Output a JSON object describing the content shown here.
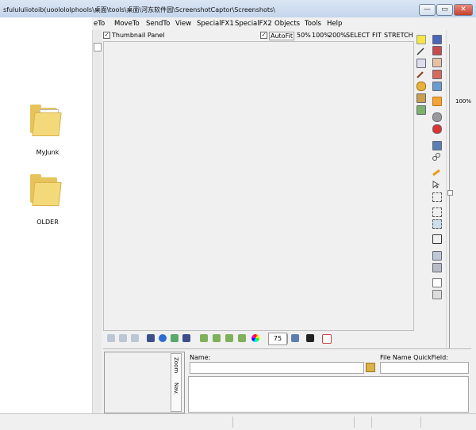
{
  "window": {
    "title": "sfulululiotoib(uoolololphools\\桌面\\tools\\桌面\\河东软件园\\ScreenshotCaptor\\Screenshots\\",
    "min": "—",
    "max": "▭",
    "close": "✕"
  },
  "menu": [
    {
      "label": "eTo"
    },
    {
      "label": "MoveTo"
    },
    {
      "label": "SendTo"
    },
    {
      "label": "View"
    },
    {
      "label": "SpecialFX1"
    },
    {
      "label": "SpecialFX2"
    },
    {
      "label": "Objects"
    },
    {
      "label": "Tools"
    },
    {
      "label": "Help"
    }
  ],
  "thumbnail_panel": {
    "label": "Thumbnail Panel",
    "checked": true
  },
  "autofit": {
    "label": "AutoFit",
    "checked": true
  },
  "zoom_presets": [
    "50%",
    "100%",
    "200%",
    "SELECT",
    "FIT",
    "STRETCH"
  ],
  "ruler": {
    "zoom_label": "100%"
  },
  "folders": [
    {
      "name": "MyJunk"
    },
    {
      "name": "OLDER"
    }
  ],
  "bottom_toolbar": {
    "zoom_value": "75"
  },
  "side_tabs": {
    "zoom": "Zoom",
    "nav": "Nav."
  },
  "name_field": {
    "label": "Name:",
    "value": ""
  },
  "quickfield": {
    "label": "File Name QuickField:",
    "value": ""
  },
  "colors": {
    "accent_yellow": "#f5e642",
    "title_blue": "#c4d5ec"
  }
}
